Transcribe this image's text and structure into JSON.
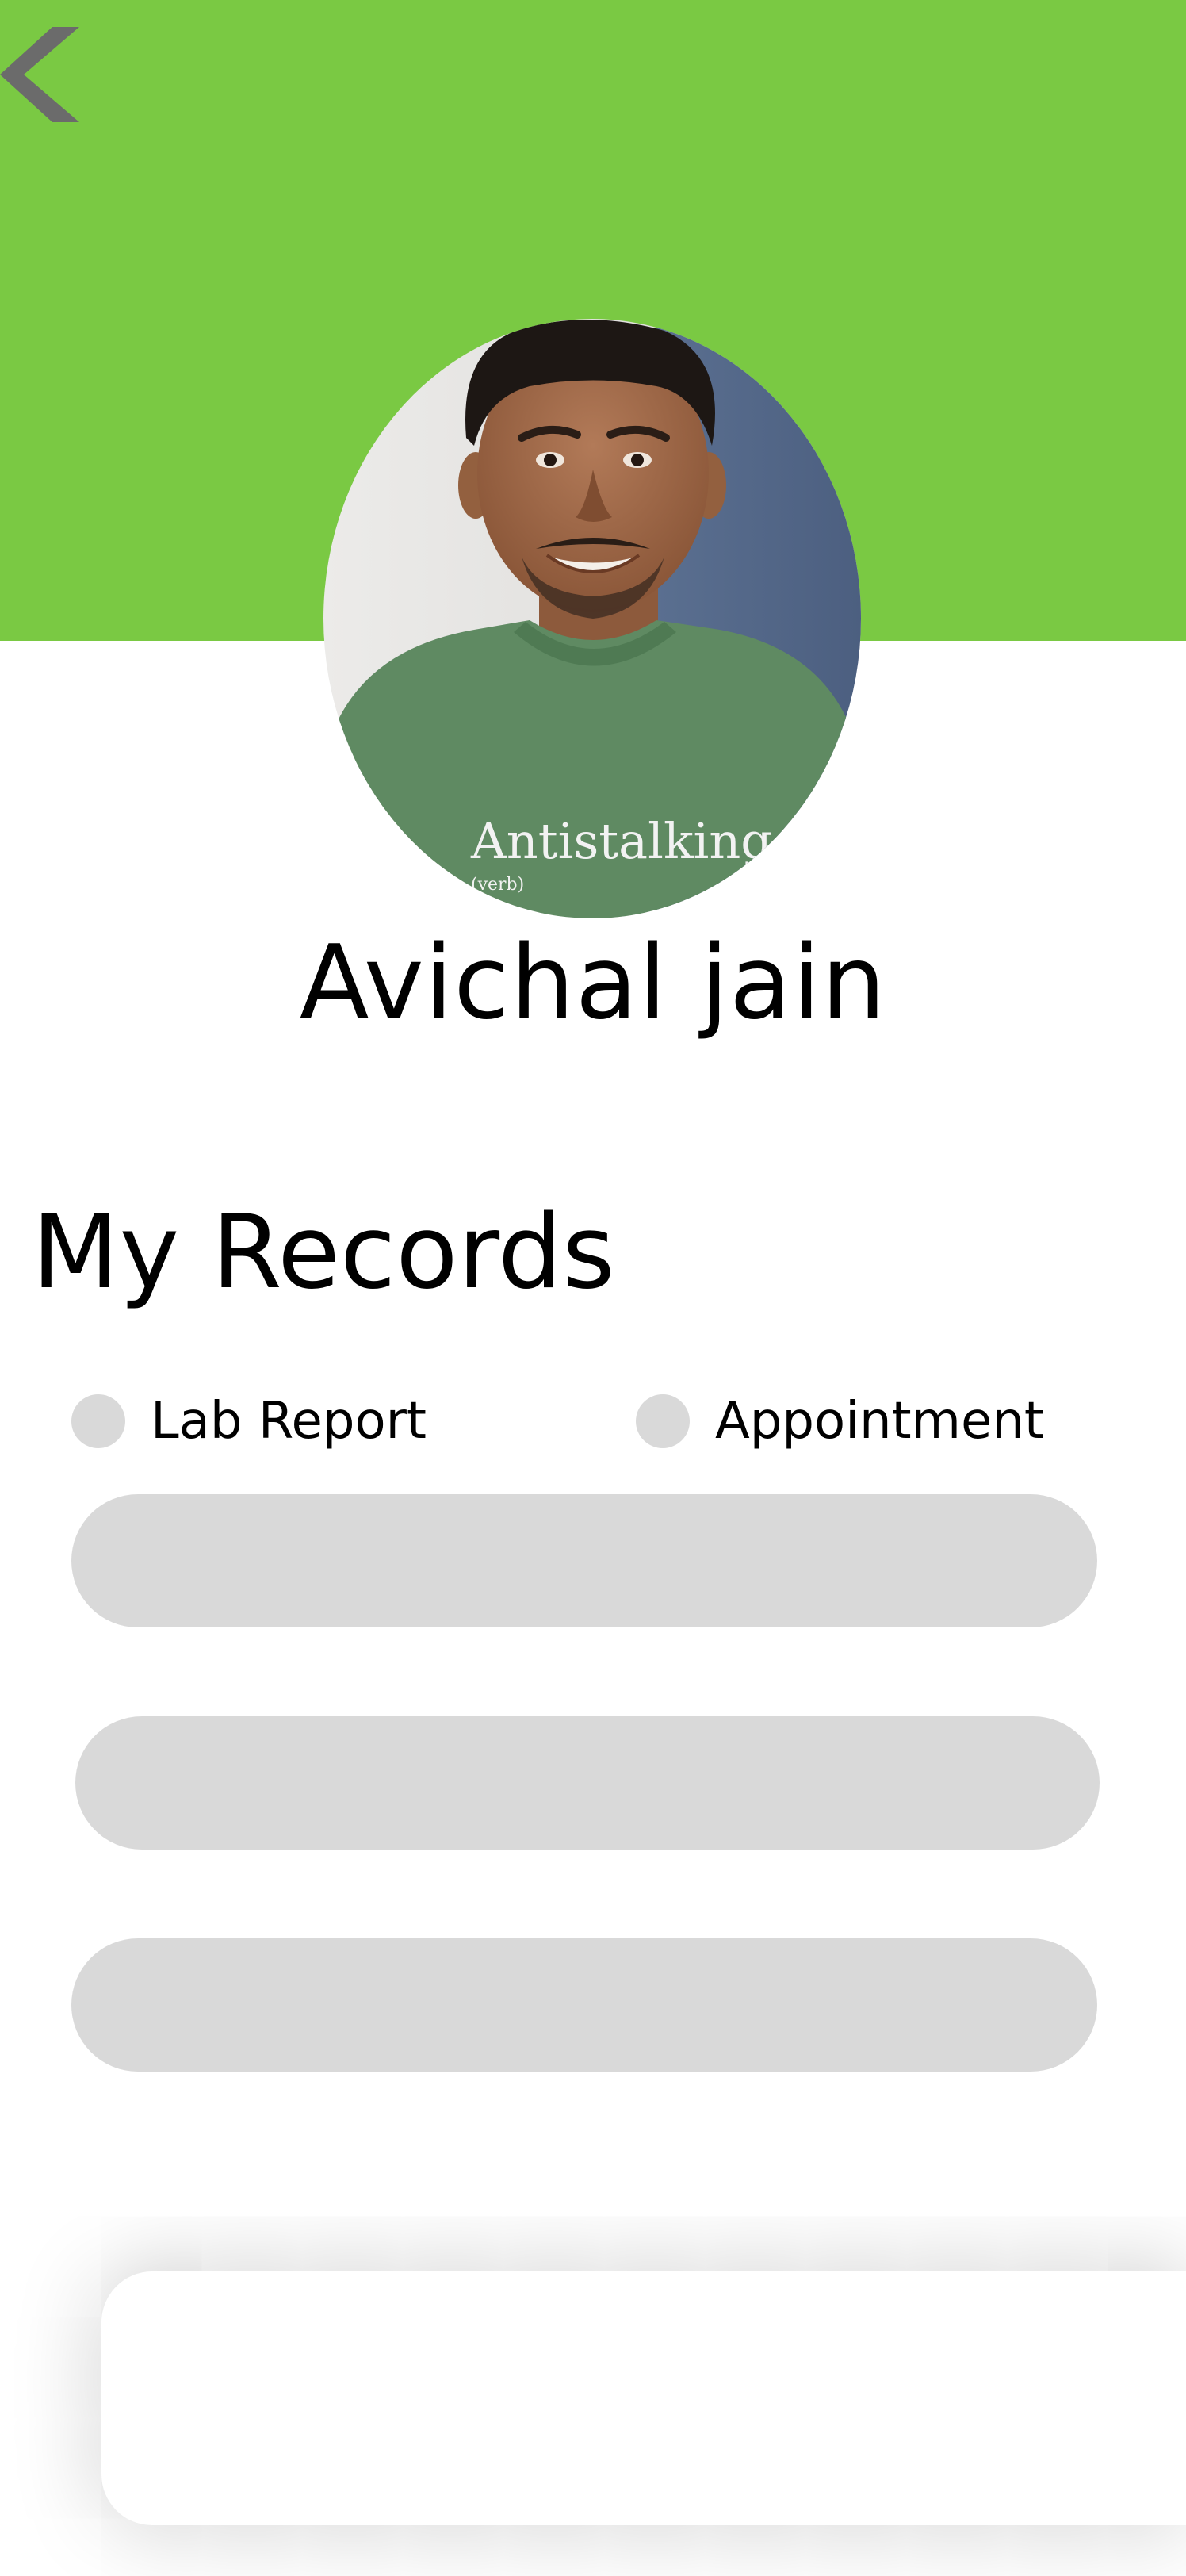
{
  "colors": {
    "header_background": "#7ac943",
    "back_icon": "#6b6b6b",
    "placeholder_gray": "#d9d9d9",
    "page_background": "#ffffff"
  },
  "header": {
    "back_icon": "chevron-left-icon"
  },
  "profile": {
    "name": "Avichal jain",
    "avatar_shirt_text": "Antistalking"
  },
  "records": {
    "title": "My Records",
    "filters": [
      {
        "label": "Lab Report"
      },
      {
        "label": "Appointment"
      }
    ],
    "items_count_visible": 3
  }
}
